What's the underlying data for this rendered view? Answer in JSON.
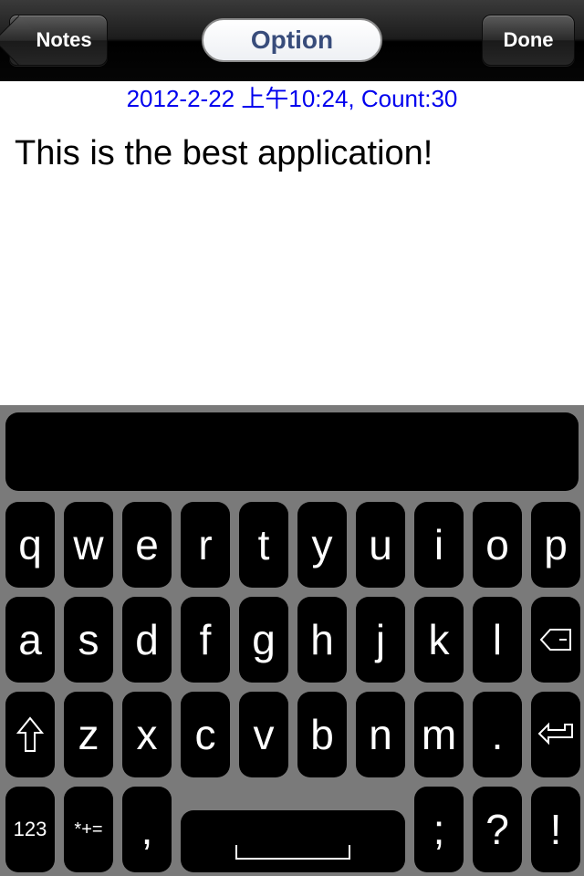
{
  "navbar": {
    "back_label": "Notes",
    "title_segment": "Option",
    "done_label": "Done"
  },
  "note": {
    "meta": "2012-2-22 上午10:24, Count:30",
    "text": "This is the best application!"
  },
  "keyboard": {
    "row1": [
      "q",
      "w",
      "e",
      "r",
      "t",
      "y",
      "u",
      "i",
      "o",
      "p"
    ],
    "row2": [
      "a",
      "s",
      "d",
      "f",
      "g",
      "h",
      "j",
      "k",
      "l"
    ],
    "row3": [
      "z",
      "x",
      "c",
      "v",
      "b",
      "n",
      "m",
      "."
    ],
    "bottom": {
      "numbers": "123",
      "symbols": "*+=",
      "comma": ",",
      "semicolon": ";",
      "question": "?",
      "exclaim": "!"
    },
    "icons": {
      "backspace": "backspace-icon",
      "shift": "shift-icon",
      "return": "return-icon"
    }
  },
  "colors": {
    "meta_blue": "#0000ee",
    "segment_text": "#384c7b",
    "keyboard_bg": "#7a7a7a"
  }
}
